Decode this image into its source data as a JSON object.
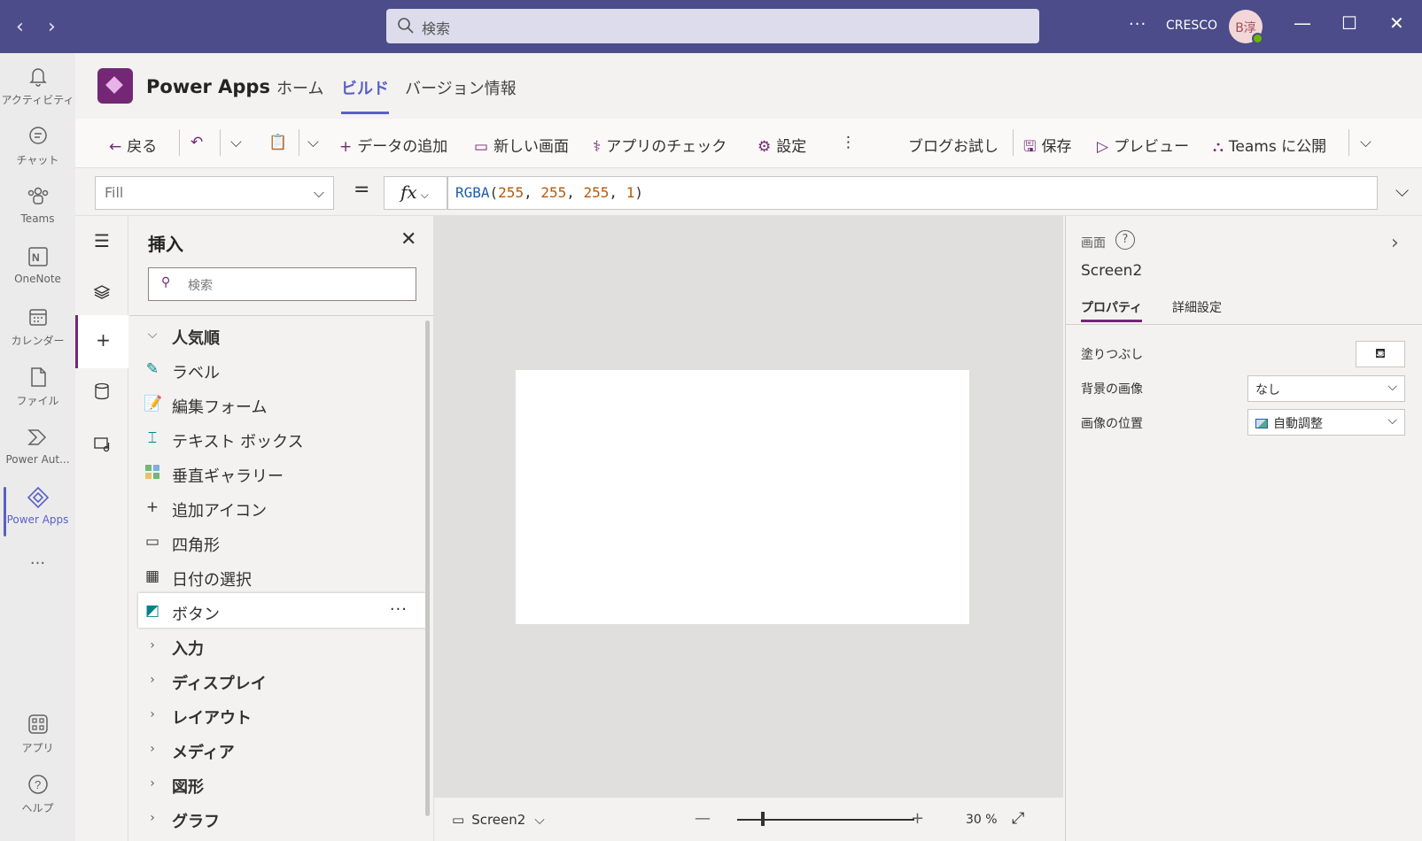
{
  "titlebar": {
    "search_placeholder": "検索",
    "more": "···",
    "org": "CRESCO",
    "avatar_initials": "B淳"
  },
  "rail": [
    {
      "label": "アクティビティ",
      "icon": "bell-icon"
    },
    {
      "label": "チャット",
      "icon": "chat-icon"
    },
    {
      "label": "Teams",
      "icon": "teams-icon"
    },
    {
      "label": "OneNote",
      "icon": "onenote-icon"
    },
    {
      "label": "カレンダー",
      "icon": "calendar-icon"
    },
    {
      "label": "ファイル",
      "icon": "file-icon"
    },
    {
      "label": "Power Aut...",
      "icon": "power-automate-icon"
    },
    {
      "label": "Power Apps",
      "icon": "power-apps-icon"
    },
    {
      "label": "アプリ",
      "icon": "apps-icon"
    },
    {
      "label": "ヘルプ",
      "icon": "help-icon"
    }
  ],
  "app": {
    "name": "Power Apps",
    "tabs": [
      "ホーム",
      "ビルド",
      "バージョン情報"
    ],
    "active_tab": "ビルド"
  },
  "toolbar": {
    "back": "戻る",
    "add_data": "データの追加",
    "new_screen": "新しい画面",
    "app_checker": "アプリのチェック",
    "settings": "設定",
    "blog": "ブログお試し",
    "save": "保存",
    "preview": "プレビュー",
    "publish": "Teams に公開"
  },
  "formula": {
    "property": "Fill",
    "fx": "fx",
    "func": "RGBA",
    "args": [
      "255",
      "255",
      "255",
      "1"
    ]
  },
  "insert": {
    "title": "挿入",
    "search_placeholder": "検索",
    "popular": "人気順",
    "items": [
      {
        "label": "ラベル",
        "icon": "label-edit-icon"
      },
      {
        "label": "編集フォーム",
        "icon": "form-edit-icon"
      },
      {
        "label": "テキスト ボックス",
        "icon": "textbox-icon"
      },
      {
        "label": "垂直ギャラリー",
        "icon": "gallery-icon"
      },
      {
        "label": "追加アイコン",
        "icon": "add-icon"
      },
      {
        "label": "四角形",
        "icon": "rectangle-icon"
      },
      {
        "label": "日付の選択",
        "icon": "calendar-icon"
      },
      {
        "label": "ボタン",
        "icon": "button-icon"
      }
    ],
    "categories": [
      "入力",
      "ディスプレイ",
      "レイアウト",
      "メディア",
      "図形",
      "グラフ"
    ]
  },
  "canvas": {
    "screen_name": "Screen2",
    "zoom_value": "30",
    "zoom_unit": "%"
  },
  "props": {
    "kind_label": "画面",
    "name": "Screen2",
    "tabs": [
      "プロパティ",
      "詳細設定"
    ],
    "fill_label": "塗りつぶし",
    "bg_image_label": "背景の画像",
    "bg_image_value": "なし",
    "image_pos_label": "画像の位置",
    "image_pos_value": "自動調整"
  }
}
